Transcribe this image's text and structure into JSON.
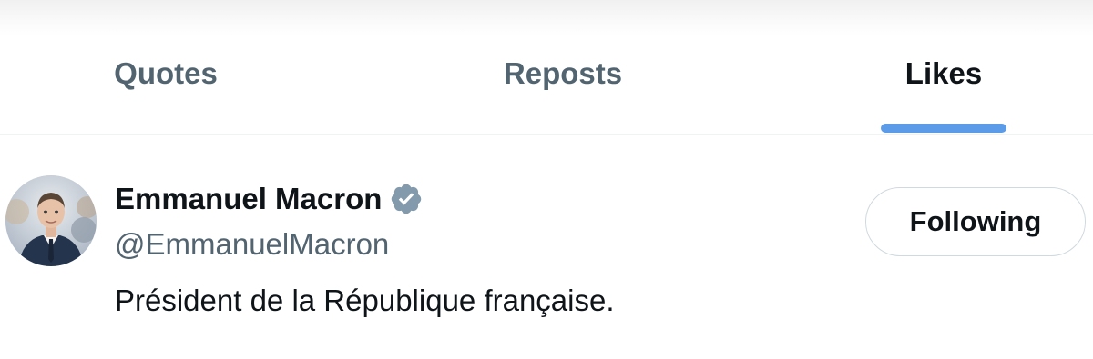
{
  "tabs": [
    {
      "label": "Quotes",
      "active": false
    },
    {
      "label": "Reposts",
      "active": false
    },
    {
      "label": "Likes",
      "active": true
    }
  ],
  "user": {
    "display_name": "Emmanuel Macron",
    "handle": "@EmmanuelMacron",
    "bio": "Président de la République française.",
    "verified": true,
    "follow_button_label": "Following"
  },
  "colors": {
    "accent_indicator": "#5b9be8",
    "text_primary": "#0f1419",
    "text_secondary": "#536471",
    "verified_badge": "#829aab",
    "border": "#cfd9de"
  },
  "icons": {
    "verified": "verified-badge-icon"
  }
}
